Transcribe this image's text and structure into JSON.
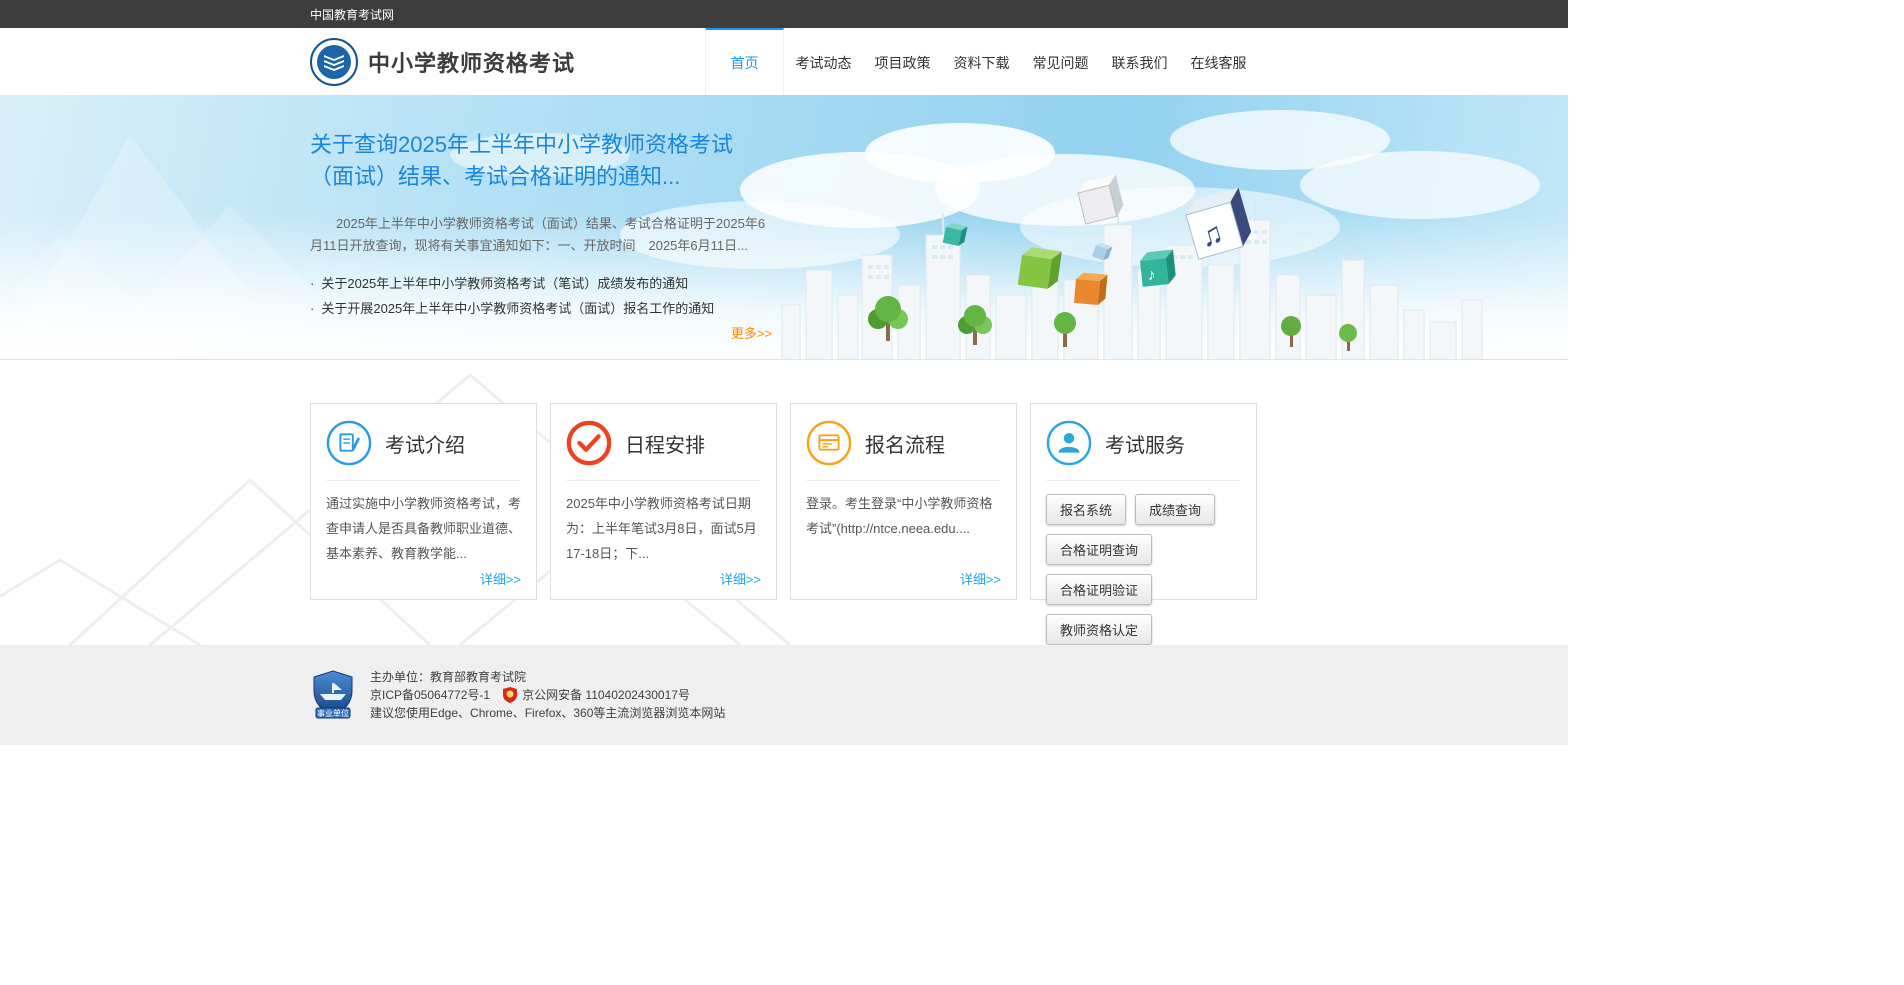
{
  "theme": {
    "accent_blue": "#2196f3",
    "hero_title_blue": "#1b87d9",
    "more_link_orange": "#ff8a00",
    "detail_link_blue": "#29a3e8",
    "topbar_dark": "#3d3d3d",
    "footer_gray": "#efefef"
  },
  "topbar": {
    "site_name": "中国教育考试网"
  },
  "header": {
    "title": "中小学教师资格考试",
    "nav": [
      {
        "label": "首页",
        "active": true
      },
      {
        "label": "考试动态",
        "active": false
      },
      {
        "label": "项目政策",
        "active": false
      },
      {
        "label": "资料下载",
        "active": false
      },
      {
        "label": "常见问题",
        "active": false
      },
      {
        "label": "联系我们",
        "active": false
      },
      {
        "label": "在线客服",
        "active": false
      }
    ]
  },
  "hero": {
    "title": "关于查询2025年上半年中小学教师资格考试（面试）结果、考试合格证明的通知...",
    "summary": "2025年上半年中小学教师资格考试（面试）结果、考试合格证明于2025年6月11日开放查询，现将有关事宜通知如下：一、开放时间　2025年6月11日...",
    "links": [
      "关于2025年上半年中小学教师资格考试（笔试）成绩发布的通知",
      "关于开展2025年上半年中小学教师资格考试（面试）报名工作的通知"
    ],
    "more_label": "更多>>"
  },
  "cards": [
    {
      "title": "考试介绍",
      "body": "通过实施中小学教师资格考试，考查申请人是否具备教师职业道德、基本素养、教育教学能...",
      "link": "详细>>"
    },
    {
      "title": "日程安排",
      "body": "2025年中小学教师资格考试日期为：上半年笔试3月8日，面试5月17-18日；下...",
      "link": "详细>>"
    },
    {
      "title": "报名流程",
      "body": "登录。考生登录“中小学教师资格考试”(http://ntce.neea.edu....",
      "link": "详细>>"
    },
    {
      "title": "考试服务",
      "buttons": [
        "报名系统",
        "成绩查询",
        "合格证明查询",
        "合格证明验证",
        "教师资格认定"
      ]
    }
  ],
  "footer": {
    "organizer": "主办单位：教育部教育考试院",
    "icp": "京ICP备05064772号-1",
    "police": "京公网安备 11040202430017号",
    "browser_tip": "建议您使用Edge、Chrome、Firefox、360等主流浏览器浏览本网站",
    "badge_label": "事业单位"
  }
}
